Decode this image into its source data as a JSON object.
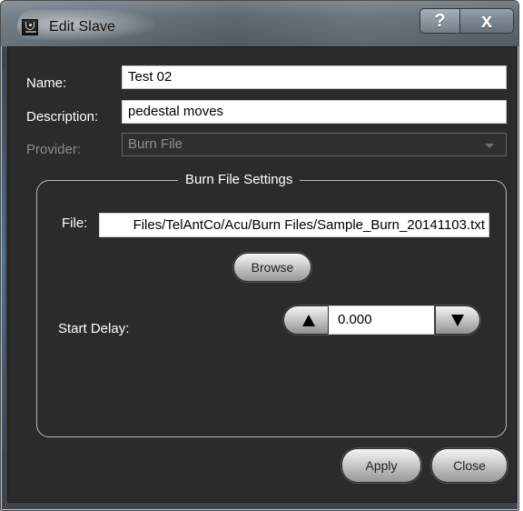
{
  "window": {
    "title": "Edit Slave",
    "icon": "app-icon"
  },
  "titlebar": {
    "help_label": "?",
    "close_label": "x"
  },
  "form": {
    "name_label": "Name:",
    "name_value": "Test 02",
    "description_label": "Description:",
    "description_value": "pedestal moves",
    "provider_label": "Provider:",
    "provider_value": "Burn File"
  },
  "burn_file_settings": {
    "title": "Burn File Settings",
    "file_label": "File:",
    "file_value": "Files/TelAntCo/Acu/Burn Files/Sample_Burn_20141103.txt",
    "browse_label": "Browse",
    "start_delay_label": "Start Delay:",
    "start_delay_value": "0.000"
  },
  "footer": {
    "apply_label": "Apply",
    "close_label": "Close"
  },
  "colors": {
    "client_background": "#2b2b2b",
    "window_frame": "#5a636c",
    "text_primary": "#ffffff",
    "text_disabled": "#8d8d8d"
  }
}
